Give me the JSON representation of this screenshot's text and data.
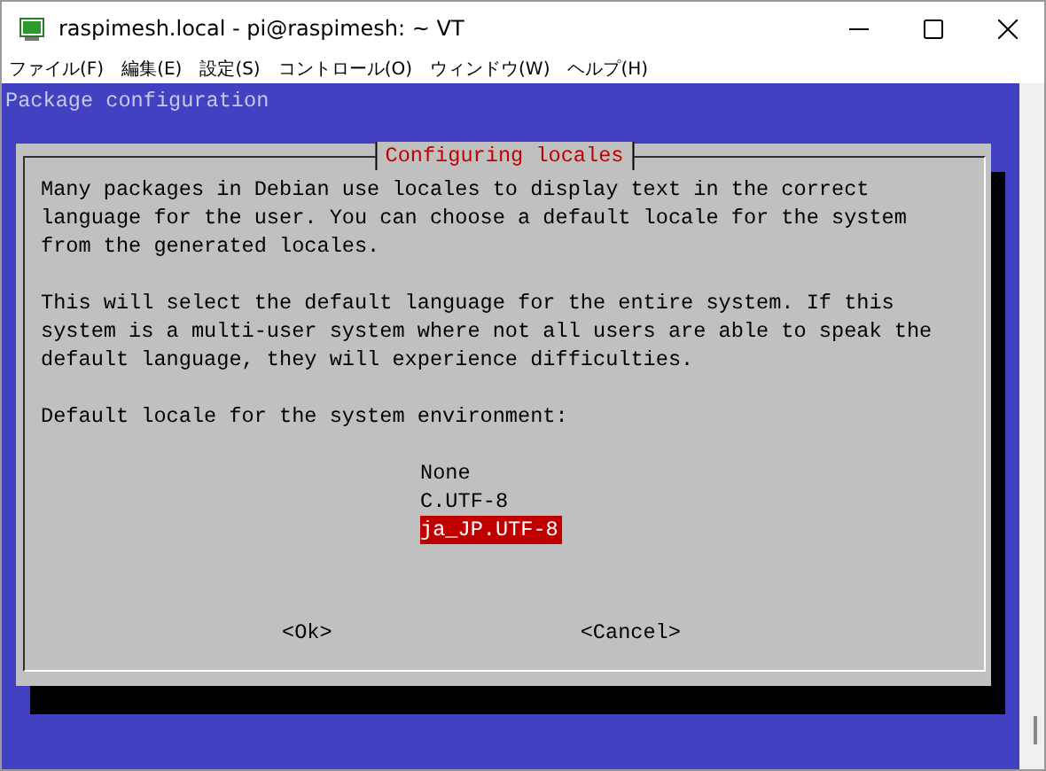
{
  "window": {
    "title": "raspimesh.local - pi@raspimesh: ~ VT"
  },
  "menu": [
    "ファイル(F)",
    "編集(E)",
    "設定(S)",
    "コントロール(O)",
    "ウィンドウ(W)",
    "ヘルプ(H)"
  ],
  "terminal": {
    "header": "Package configuration",
    "dialog": {
      "title": "Configuring locales",
      "paragraphs": [
        "Many packages in Debian use locales to display text in the correct language for the user. You can choose a default locale for the system from the generated locales.",
        "This will select the default language for the entire system. If this system is a multi-user system where not all users are able to speak the default language, they will experience difficulties."
      ],
      "prompt": "Default locale for the system environment:",
      "options": [
        {
          "label": "None",
          "selected": false
        },
        {
          "label": "C.UTF-8",
          "selected": false
        },
        {
          "label": "ja_JP.UTF-8",
          "selected": true
        }
      ],
      "buttons": [
        "<Ok>",
        "<Cancel>"
      ]
    }
  }
}
